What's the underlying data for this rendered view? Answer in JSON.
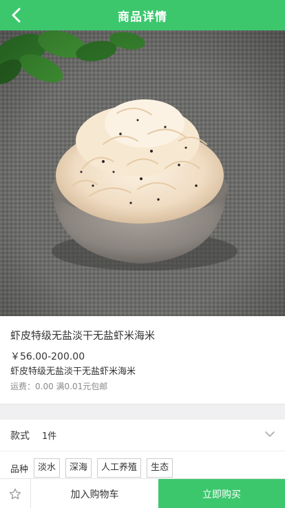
{
  "header": {
    "title": "商品详情"
  },
  "product": {
    "name": "虾皮特级无盐淡干无盐虾米海米",
    "price": "￥56.00-200.00",
    "subtitle": "虾皮特级无盐淡干无盐虾米海米",
    "shipping": "运费：0.00 满0.01元包邮"
  },
  "options": {
    "style_label": "款式",
    "style_value": "1件",
    "variety_label": "品种",
    "variety_tags": [
      "淡水",
      "深海",
      "人工养殖",
      "生态"
    ]
  },
  "bottombar": {
    "cart_label": "加入购物车",
    "buy_label": "立即购买"
  },
  "colors": {
    "accent": "#3cc76d"
  }
}
